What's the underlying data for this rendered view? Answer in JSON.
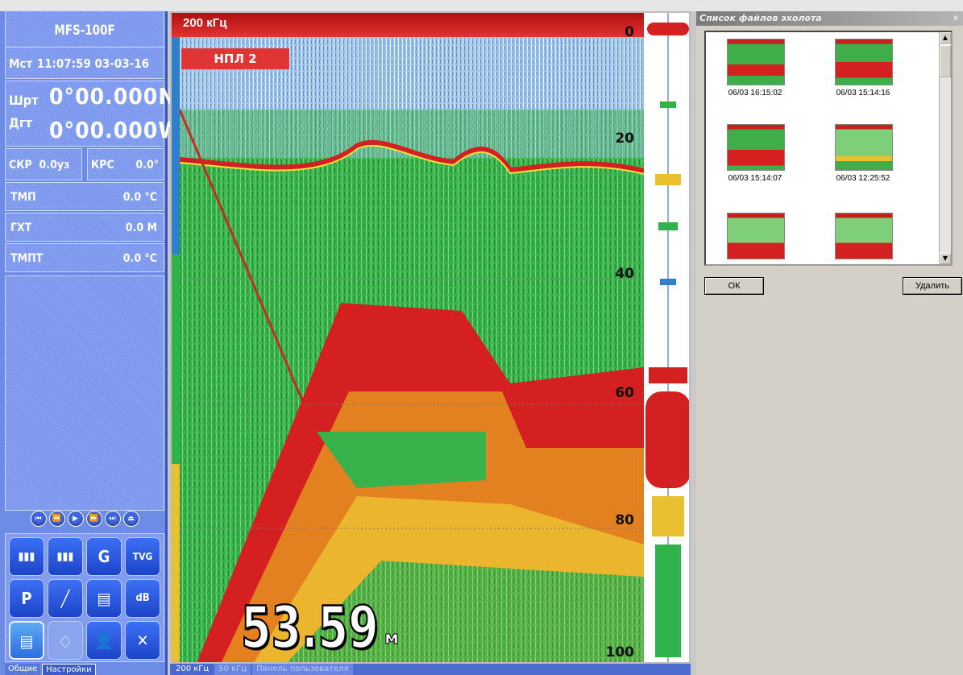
{
  "device": {
    "name": "MFS-100F"
  },
  "time": {
    "label": "Мст",
    "value": "11:07:59 03-03-16"
  },
  "position": {
    "lat_label": "Шрт",
    "lat": "0°00.000N",
    "lon_label": "Дгт",
    "lon": "0°00.000W"
  },
  "speed": {
    "label": "СКР",
    "value": "0.0уз"
  },
  "course": {
    "label": "КРС",
    "value": "0.0°"
  },
  "readings": [
    {
      "label": "ТМП",
      "value": "0.0 °C"
    },
    {
      "label": "ГХТ",
      "value": "0.0 M"
    },
    {
      "label": "ТМПТ",
      "value": "0.0 °C"
    }
  ],
  "playback": [
    "⏮",
    "⏪",
    "▶",
    "⏩",
    "⏭",
    "⏏"
  ],
  "tools": [
    "▮▮▮",
    "▮▮▮",
    "G",
    "TVG",
    "P",
    "╱",
    "▤",
    "dB",
    "▤",
    "◇",
    "👤",
    "✕"
  ],
  "left_tabs": [
    "Общие",
    "Настройки"
  ],
  "echo": {
    "freq": "200 кГц",
    "mode": "НПЛ 2",
    "depth_ticks": [
      "0",
      "20",
      "40",
      "60",
      "80",
      "100"
    ],
    "depth_value": "53.59",
    "depth_unit": "м"
  },
  "bottom_tabs": [
    "200 кГц",
    "50 кГц",
    "Панель пользователя"
  ],
  "files": {
    "title": "Список файлов эхолота",
    "close": "x",
    "items": [
      {
        "caption": "06/03 16:15:02"
      },
      {
        "caption": "06/03 15:14:16"
      },
      {
        "caption": "06/03 15:14:07"
      },
      {
        "caption": "06/03 12:25:52"
      },
      {
        "caption": ""
      },
      {
        "caption": ""
      }
    ],
    "ok_label": "ОК",
    "delete_label": "Удалить"
  },
  "colors": {
    "panel": "#6d8ce6",
    "echo_red": "#d42020",
    "echo_green": "#2fb34a",
    "echo_yellow": "#f2e23a",
    "echo_blue": "#3a78d8"
  }
}
